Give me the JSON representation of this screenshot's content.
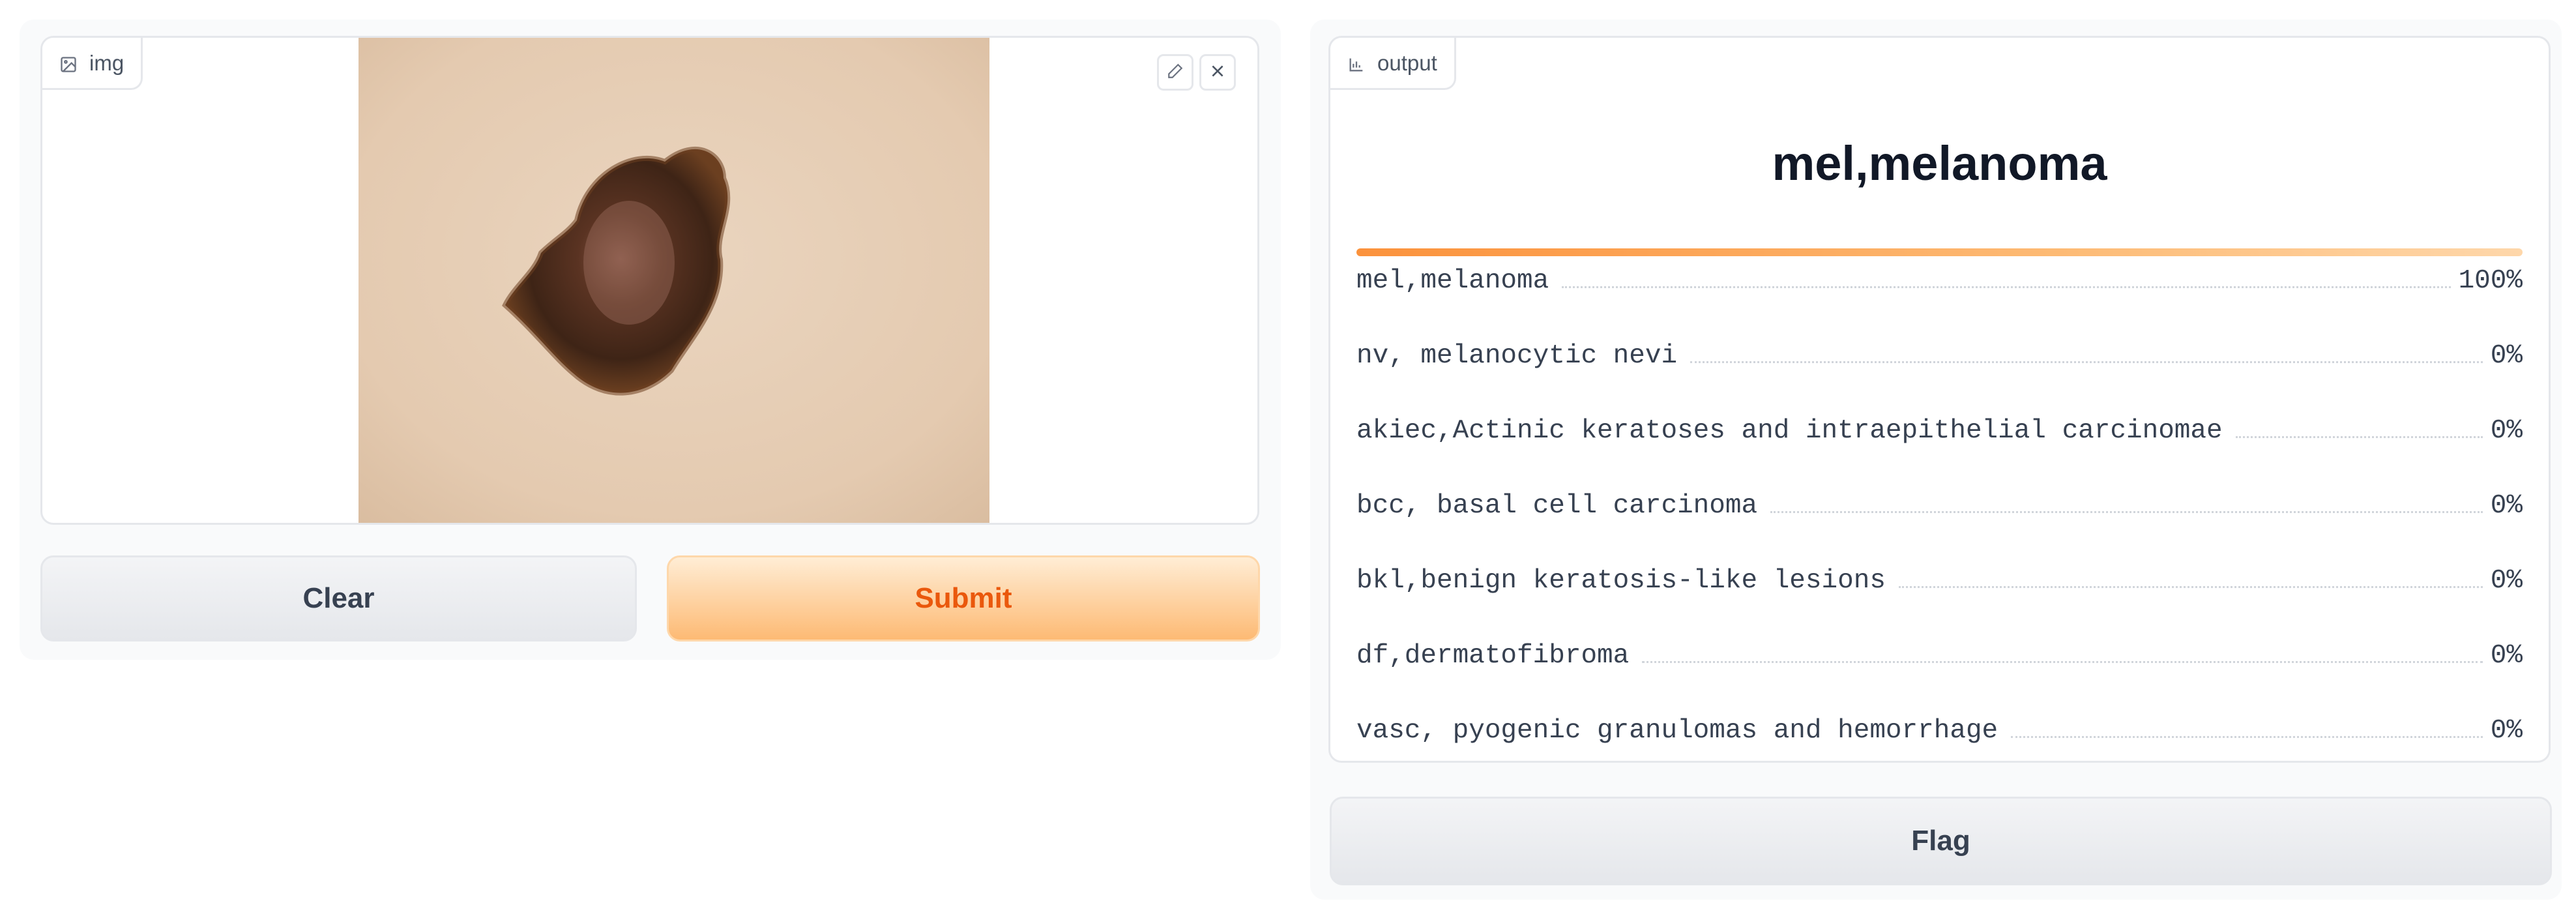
{
  "input_panel": {
    "label": "img",
    "label_icon": "image-icon",
    "edit_icon": "pencil-icon",
    "close_icon": "close-icon",
    "clear_label": "Clear",
    "submit_label": "Submit"
  },
  "output_panel": {
    "label": "output",
    "label_icon": "bar-chart-icon",
    "predicted_label": "mel,melanoma",
    "confidences": [
      {
        "label": "mel,melanoma",
        "value": 1.0,
        "display": "100%"
      },
      {
        "label": "nv, melanocytic nevi",
        "value": 0.0,
        "display": "0%"
      },
      {
        "label": "akiec,Actinic keratoses and intraepithelial carcinomae",
        "value": 0.0,
        "display": "0%"
      },
      {
        "label": "bcc, basal cell carcinoma",
        "value": 0.0,
        "display": "0%"
      },
      {
        "label": "bkl,benign keratosis-like lesions",
        "value": 0.0,
        "display": "0%"
      },
      {
        "label": "df,dermatofibroma",
        "value": 0.0,
        "display": "0%"
      },
      {
        "label": "vasc, pyogenic granulomas and hemorrhage",
        "value": 0.0,
        "display": "0%"
      }
    ],
    "flag_label": "Flag"
  },
  "colors": {
    "accent": "#ea580c",
    "bar": "#fb923c",
    "skin": "#e6cdb3",
    "lesion": "#4a2a1a"
  }
}
